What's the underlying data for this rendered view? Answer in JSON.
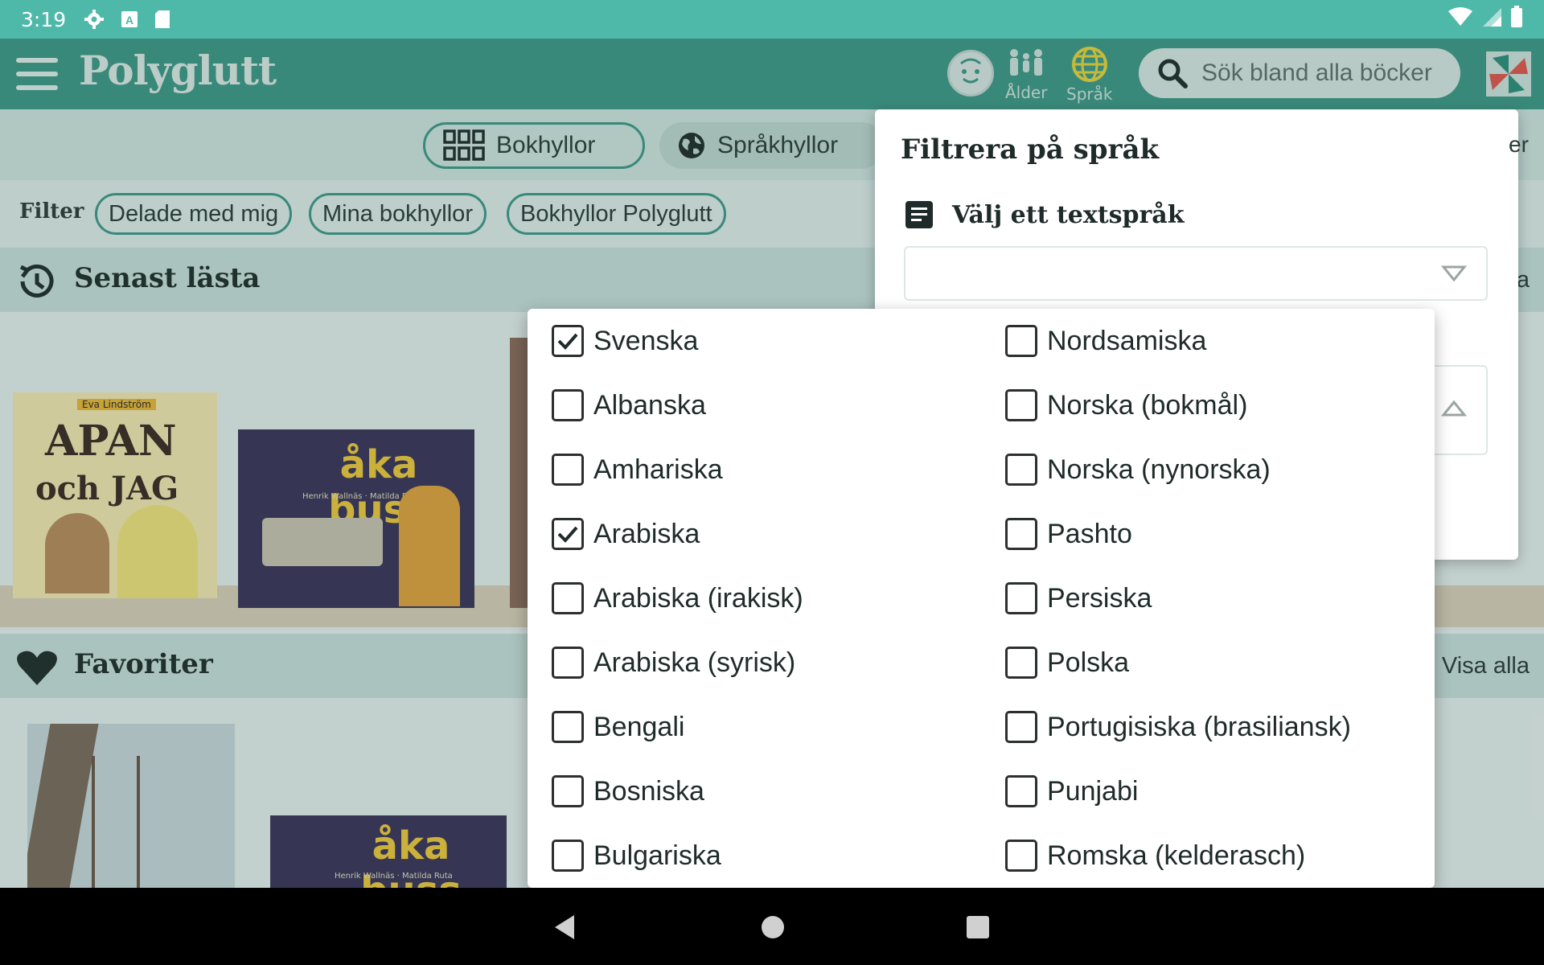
{
  "status_bar": {
    "time": "3:19"
  },
  "header": {
    "app_name": "Polyglutt",
    "age_label": "Ålder",
    "language_label": "Språk",
    "search_placeholder": "Sök bland alla böcker"
  },
  "tabs": [
    {
      "label": "Bokhyllor",
      "active": true
    },
    {
      "label": "Språkhyllor",
      "active": false
    }
  ],
  "filter": {
    "label": "Filter",
    "chips": [
      "Delade med mig",
      "Mina bokhyllor",
      "Bokhyllor Polyglutt"
    ]
  },
  "sections": {
    "recent": {
      "title": "Senast lästa",
      "link_partial": "a"
    },
    "favorites": {
      "title": "Favoriter",
      "link": "Visa alla"
    }
  },
  "books": {
    "recent": [
      {
        "title_line1": "APAN",
        "title_line2": "och JAG",
        "author": "Eva Lindström"
      },
      {
        "title_line1": "åka buss",
        "author": "Henrik Wallnäs · Matilda Ruta"
      }
    ],
    "favorites": [
      {
        "title_line1": ""
      },
      {
        "title_line1": "åka buss",
        "author": "Henrik Wallnäs · Matilda Ruta"
      }
    ]
  },
  "panel": {
    "title": "Filtrera på språk",
    "text_language_label": "Välj ett textspråk",
    "text_language_value": "",
    "side_partial": "er"
  },
  "language_options": {
    "left": [
      {
        "label": "Svenska",
        "checked": true
      },
      {
        "label": "Albanska",
        "checked": false
      },
      {
        "label": "Amhariska",
        "checked": false
      },
      {
        "label": "Arabiska",
        "checked": true
      },
      {
        "label": "Arabiska (irakisk)",
        "checked": false
      },
      {
        "label": "Arabiska (syrisk)",
        "checked": false
      },
      {
        "label": "Bengali",
        "checked": false
      },
      {
        "label": "Bosniska",
        "checked": false
      },
      {
        "label": "Bulgariska",
        "checked": false
      }
    ],
    "right": [
      {
        "label": "Nordsamiska",
        "checked": false
      },
      {
        "label": "Norska (bokmål)",
        "checked": false
      },
      {
        "label": "Norska (nynorska)",
        "checked": false
      },
      {
        "label": "Pashto",
        "checked": false
      },
      {
        "label": "Persiska",
        "checked": false
      },
      {
        "label": "Polska",
        "checked": false
      },
      {
        "label": "Portugisiska (brasiliansk)",
        "checked": false
      },
      {
        "label": "Punjabi",
        "checked": false
      },
      {
        "label": "Romska (kelderasch)",
        "checked": false
      }
    ]
  },
  "colors": {
    "status_bar": "#4fb9a9",
    "app_bar": "#3d9888",
    "accent": "#3d9888"
  }
}
